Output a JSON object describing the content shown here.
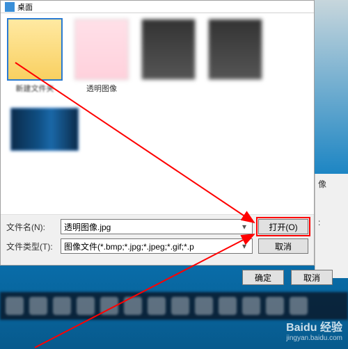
{
  "breadcrumb": {
    "text": "桌面"
  },
  "files": {
    "folder_label": "新建文件夹",
    "transparent_label": "透明图像",
    "item3_label": " ",
    "item4_label": " ",
    "item5_label": " "
  },
  "labels": {
    "filename": "文件名(N):",
    "filetype": "文件类型(T):"
  },
  "inputs": {
    "filename_value": "透明图像.jpg",
    "filetype_value": "图像文件(*.bmp;*.jpg;*.jpeg;*.gif;*.p"
  },
  "buttons": {
    "open": "打开(O)",
    "cancel": "取消",
    "ok2": "确定",
    "cancel2": "取消"
  },
  "side": {
    "label1": "像",
    "label2": ":"
  },
  "watermark": {
    "brand": "Baidu 经验",
    "url": "jingyan.baidu.com"
  }
}
